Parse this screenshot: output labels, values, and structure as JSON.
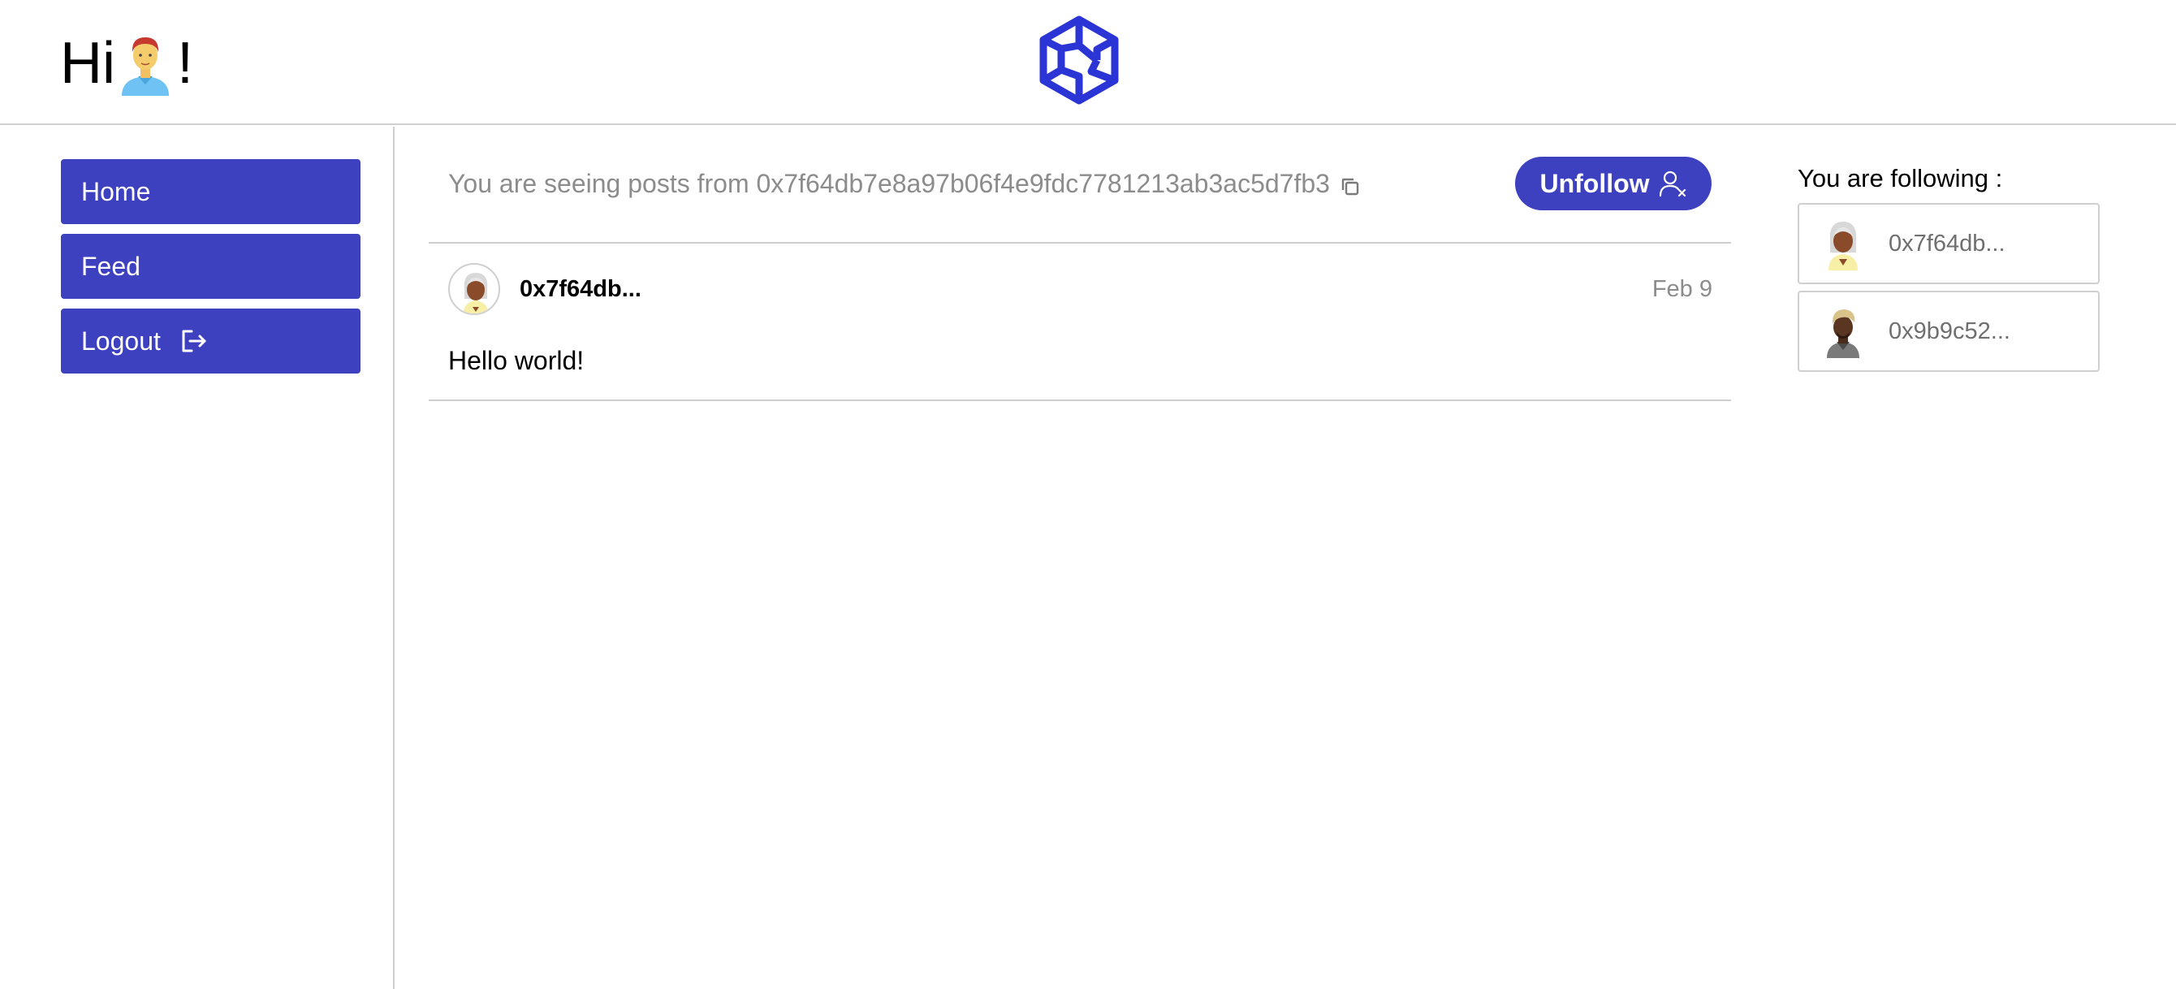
{
  "header": {
    "greeting_prefix": "Hi",
    "greeting_suffix": "!",
    "user_avatar": "man-red-hair-avatar",
    "logo": "hexagon-logo"
  },
  "nav": {
    "items": [
      {
        "label": "Home",
        "icon": ""
      },
      {
        "label": "Feed",
        "icon": ""
      },
      {
        "label": "Logout",
        "icon": "logout-icon"
      }
    ]
  },
  "main": {
    "seeing_text": "You are seeing posts from 0x7f64db7e8a97b06f4e9fdc7781213ab3ac5d7fb3",
    "copy_icon": "copy-icon",
    "unfollow_label": "Unfollow",
    "unfollow_icon": "user-remove-icon",
    "posts": [
      {
        "author": "0x7f64db...",
        "date": "Feb 9",
        "body": "Hello world!",
        "avatar": "woman-gray-hair-avatar"
      }
    ]
  },
  "sidebar_right": {
    "title": "You are following :",
    "following": [
      {
        "label": "0x7f64db...",
        "avatar": "woman-gray-hair-avatar"
      },
      {
        "label": "0x9b9c52...",
        "avatar": "man-blonde-hair-avatar"
      }
    ]
  },
  "colors": {
    "accent": "#3d41bf",
    "logo": "#2b35d6",
    "border": "#cfcfcf",
    "muted_text": "#8c8c8c"
  }
}
